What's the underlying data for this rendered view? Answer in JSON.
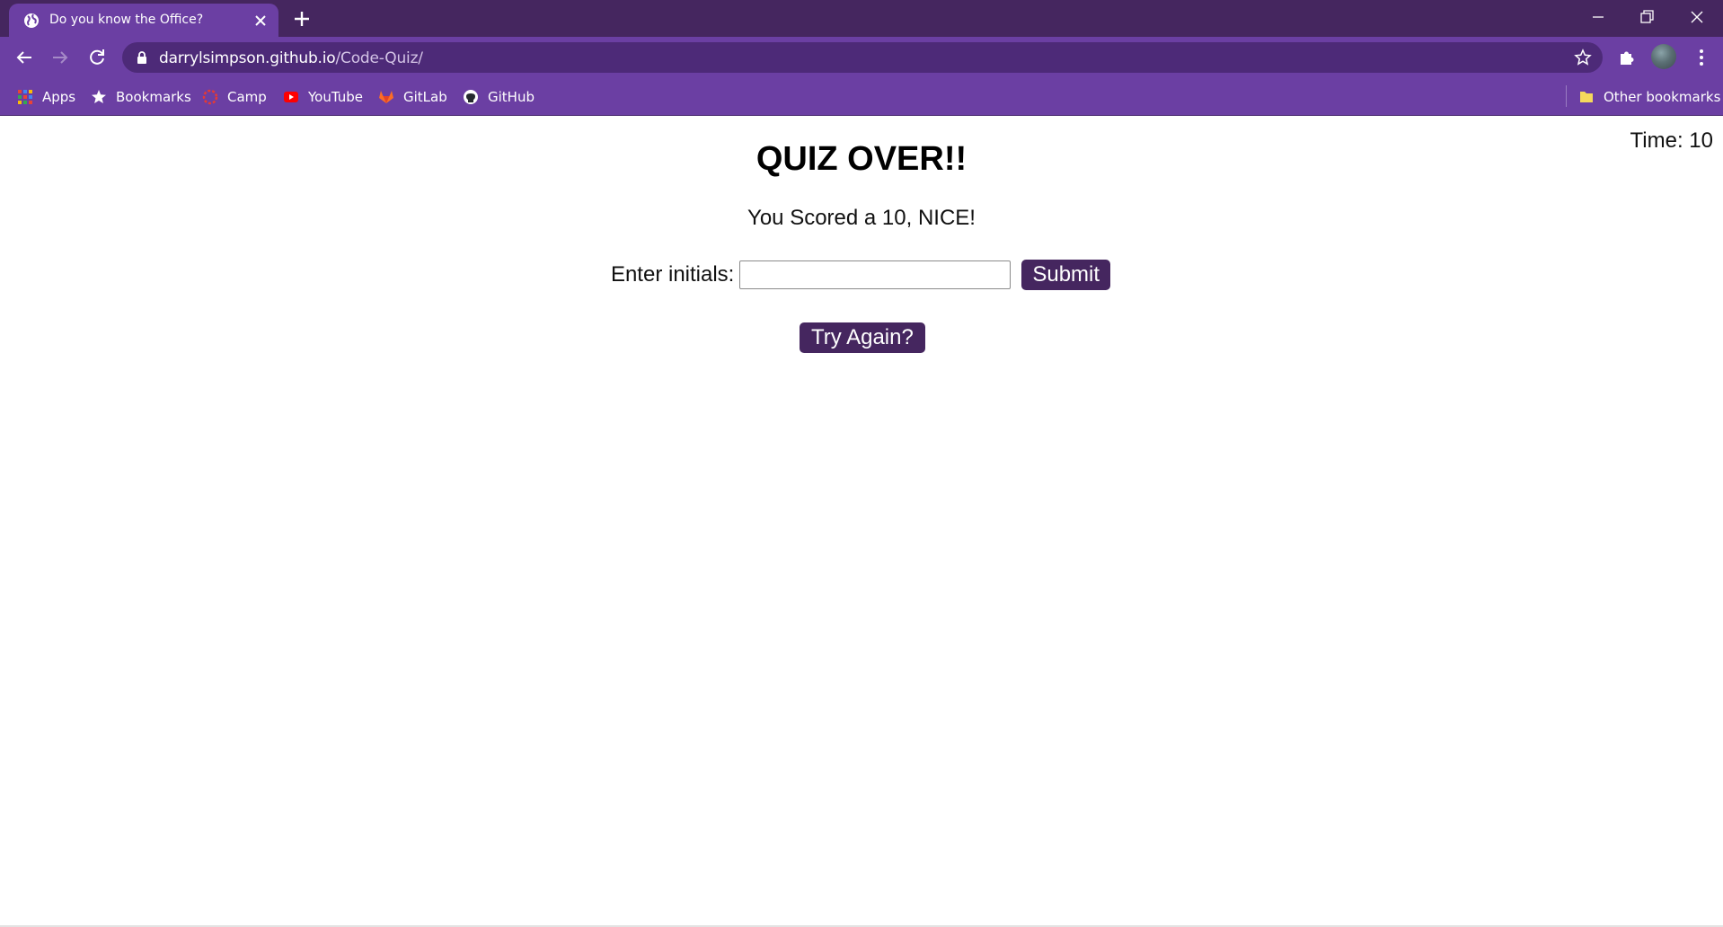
{
  "browser": {
    "tab_title": "Do you know the Office?",
    "url_domain": "darrylsimpson.github.io",
    "url_path": "/Code-Quiz/",
    "bookmarks": [
      {
        "label": "Apps",
        "icon": "apps-grid-icon"
      },
      {
        "label": "Bookmarks",
        "icon": "star-icon"
      },
      {
        "label": "Camp",
        "icon": "camp-icon"
      },
      {
        "label": "YouTube",
        "icon": "youtube-icon"
      },
      {
        "label": "GitLab",
        "icon": "gitlab-icon"
      },
      {
        "label": "GitHub",
        "icon": "github-icon"
      }
    ],
    "other_bookmarks": "Other bookmarks",
    "colors": {
      "tabstrip": "#45265f",
      "toolbar": "#6b3fa3"
    }
  },
  "quiz": {
    "timer": "Time: 10",
    "title": "QUIZ OVER!!",
    "score_text": "You Scored a 10, NICE!",
    "initials_label": "Enter initials:",
    "initials_value": "",
    "submit_label": "Submit",
    "try_again_label": "Try Again?",
    "button_color": "#45265f"
  }
}
